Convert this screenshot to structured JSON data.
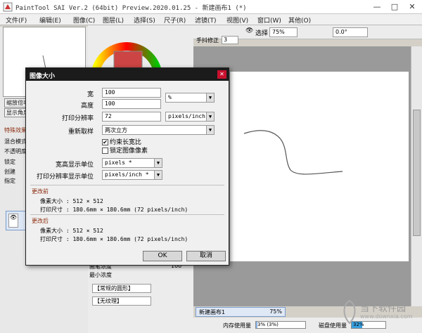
{
  "app": {
    "title": "PaintTool SAI Ver.2 (64bit) Preview.2020.01.25 - 新建画布1 (*)",
    "minimize": "—",
    "maximize": "□",
    "close": "✕"
  },
  "menu": [
    "文件(F)",
    "编辑(E)",
    "图像(C)",
    "图层(L)",
    "选择(S)",
    "尺子(R)",
    "滤镜(T)",
    "视图(V)",
    "窗口(W)",
    "其他(O)"
  ],
  "toolbar": {
    "selection_label": "选择",
    "zoom": "75%",
    "rotation": "0.0°",
    "stabilizer_label": "手抖修正",
    "stabilizer_value": "3"
  },
  "left_panel": {
    "btn1": "缩放倍率",
    "btn2": "显示角度",
    "section": "特殊效果",
    "blend_mode": "混合模式",
    "opacity": "不透明度",
    "lock": "锁定",
    "create": "创建",
    "designate": "指定"
  },
  "brush_panel": {
    "density": "画笔浓度",
    "density_value": "100",
    "min_density": "最小浓度",
    "shape": "【常规的圆形】",
    "texture": "【无纹理】"
  },
  "document_tab": {
    "name": "新建画布1",
    "zoom": "75%"
  },
  "status": {
    "memory_label": "内存使用量",
    "memory_value": "3% (3%)",
    "memory_fraction": 0.03,
    "disk_label": "磁盘使用量",
    "disk_value": "32%",
    "disk_fraction": 0.32
  },
  "dialog": {
    "title": "图像大小",
    "close": "✕",
    "width_label": "宽",
    "width_value": "100",
    "height_label": "高度",
    "height_value": "100",
    "size_unit": "%",
    "resolution_label": "打印分辨率",
    "resolution_value": "72",
    "resolution_unit": "pixels/inch",
    "resample_label": "重新取样",
    "resample_value": "两次立方",
    "keep_ratio": "约束长宽比",
    "keep_ratio_checked": true,
    "lock_pixels": "锁定图像像素",
    "lock_pixels_checked": false,
    "wh_unit_label": "宽高显示单位",
    "wh_unit_value": "pixels *",
    "res_unit_label": "打印分辨率显示单位",
    "res_unit_value": "pixels/inch *",
    "before_label": "更改前",
    "before_pixels": "像素大小 :  512 × 512",
    "before_print": "打印尺寸 :  180.6mm × 180.6mm (72 pixels/inch)",
    "after_label": "更改后",
    "after_pixels": "像素大小 :  512 × 512",
    "after_print": "打印尺寸 :  180.6mm × 180.6mm (72 pixels/inch)",
    "ok": "OK",
    "cancel": "取消"
  },
  "watermark": {
    "text": "当下软件园",
    "url": "www.downxia.com"
  }
}
